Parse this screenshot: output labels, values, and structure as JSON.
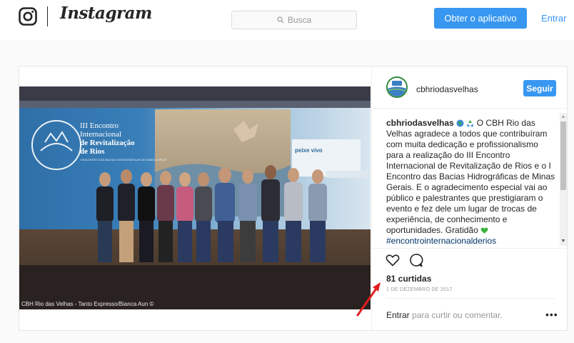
{
  "header": {
    "brand": "Instagram",
    "search_placeholder": "Busca",
    "get_app_label": "Obter o aplicativo",
    "login_label": "Entrar"
  },
  "post": {
    "username": "cbhriodasvelhas",
    "follow_label": "Seguir",
    "photo_credit": "CBH Rio das Velhas - Tanto Expresso/Bianca Aun ©",
    "caption": {
      "author": "cbhriodasvelhas",
      "text": "O CBH Rio das Velhas agradece a todos que contribuíram com muita dedicação e profissionalismo para a realização do III Encontro Internacional de Revitalização de Rios e o I Encontro das Bacias Hidrográficas de Minas Gerais. E o agradecimento especial vai ao público e palestrantes que prestigiaram o evento e fez dele um lugar de trocas de experiência, de conhecimento e oportunidades. Gratidão",
      "hashtag": "#encontrointernacionalderios"
    },
    "likes": "81 curtidas",
    "date": "1 DE DEZEMBRO DE 2017",
    "login_prompt_link": "Entrar",
    "login_prompt_rest": "para curtir ou comentar.",
    "more_label": "•••"
  },
  "banner": {
    "event_line1": "III Encontro",
    "event_line2": "Internacional",
    "event_line3": "de Revitalização",
    "event_line4": "de Rios",
    "event_sub": "I ENCONTRO DAS BACIAS HIDROGRÁFICAS DE MINAS GERAIS",
    "sponsor": "peixe vivo"
  },
  "avatar_text": "CBH Rio das Velhas",
  "icons": [
    "instagram-glyph",
    "search-icon",
    "heart-icon",
    "comment-icon",
    "more-icon"
  ],
  "colors": {
    "accent": "#3897f0",
    "annotation": "#e02020"
  }
}
